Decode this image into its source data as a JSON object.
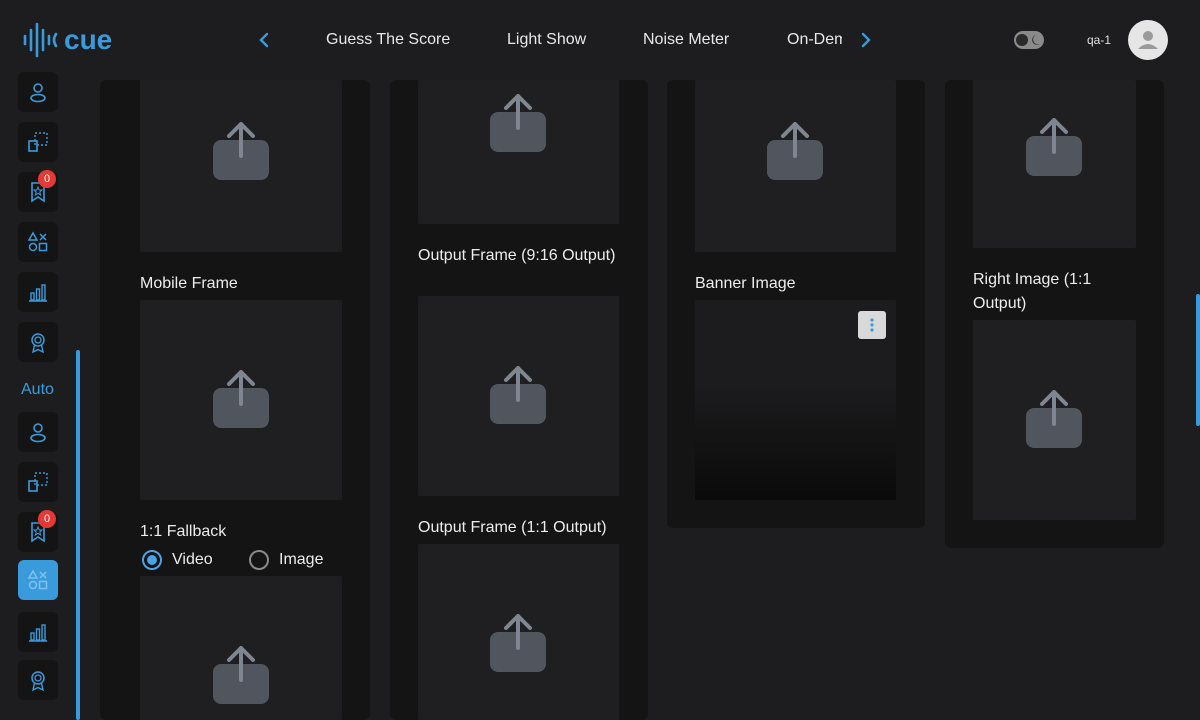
{
  "brand": {
    "name": "cue",
    "accent": "#3a9bdc"
  },
  "header": {
    "nav_items": [
      "Guess The Score",
      "Light Show",
      "Noise Meter"
    ],
    "nav_partial": "On-Demand",
    "user": "qa-1"
  },
  "sidebar": {
    "section_label": "Auto",
    "badge_count_1": "0",
    "badge_count_2": "0"
  },
  "fields": {
    "mobile_frame": "Mobile Frame",
    "fallback": "1:1 Fallback",
    "radio_video": "Video",
    "radio_image": "Image",
    "output_916": "Output Frame (9:16 Output)",
    "output_11": "Output Frame (1:1 Output)",
    "banner": "Banner Image",
    "right_image": "Right Image (1:1 Output)"
  },
  "selected_media": "Video"
}
